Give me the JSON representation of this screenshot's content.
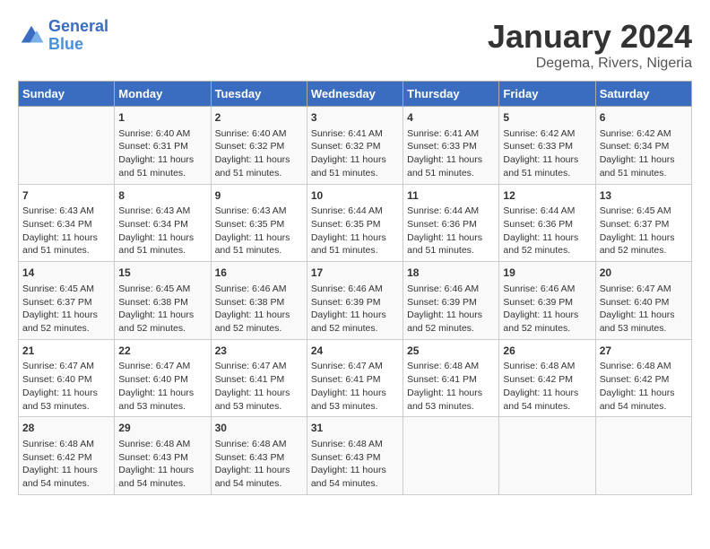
{
  "header": {
    "logo_line1": "General",
    "logo_line2": "Blue",
    "title": "January 2024",
    "subtitle": "Degema, Rivers, Nigeria"
  },
  "weekdays": [
    "Sunday",
    "Monday",
    "Tuesday",
    "Wednesday",
    "Thursday",
    "Friday",
    "Saturday"
  ],
  "weeks": [
    [
      {
        "day": "",
        "info": ""
      },
      {
        "day": "1",
        "info": "Sunrise: 6:40 AM\nSunset: 6:31 PM\nDaylight: 11 hours\nand 51 minutes."
      },
      {
        "day": "2",
        "info": "Sunrise: 6:40 AM\nSunset: 6:32 PM\nDaylight: 11 hours\nand 51 minutes."
      },
      {
        "day": "3",
        "info": "Sunrise: 6:41 AM\nSunset: 6:32 PM\nDaylight: 11 hours\nand 51 minutes."
      },
      {
        "day": "4",
        "info": "Sunrise: 6:41 AM\nSunset: 6:33 PM\nDaylight: 11 hours\nand 51 minutes."
      },
      {
        "day": "5",
        "info": "Sunrise: 6:42 AM\nSunset: 6:33 PM\nDaylight: 11 hours\nand 51 minutes."
      },
      {
        "day": "6",
        "info": "Sunrise: 6:42 AM\nSunset: 6:34 PM\nDaylight: 11 hours\nand 51 minutes."
      }
    ],
    [
      {
        "day": "7",
        "info": "Sunrise: 6:43 AM\nSunset: 6:34 PM\nDaylight: 11 hours\nand 51 minutes."
      },
      {
        "day": "8",
        "info": "Sunrise: 6:43 AM\nSunset: 6:34 PM\nDaylight: 11 hours\nand 51 minutes."
      },
      {
        "day": "9",
        "info": "Sunrise: 6:43 AM\nSunset: 6:35 PM\nDaylight: 11 hours\nand 51 minutes."
      },
      {
        "day": "10",
        "info": "Sunrise: 6:44 AM\nSunset: 6:35 PM\nDaylight: 11 hours\nand 51 minutes."
      },
      {
        "day": "11",
        "info": "Sunrise: 6:44 AM\nSunset: 6:36 PM\nDaylight: 11 hours\nand 51 minutes."
      },
      {
        "day": "12",
        "info": "Sunrise: 6:44 AM\nSunset: 6:36 PM\nDaylight: 11 hours\nand 52 minutes."
      },
      {
        "day": "13",
        "info": "Sunrise: 6:45 AM\nSunset: 6:37 PM\nDaylight: 11 hours\nand 52 minutes."
      }
    ],
    [
      {
        "day": "14",
        "info": "Sunrise: 6:45 AM\nSunset: 6:37 PM\nDaylight: 11 hours\nand 52 minutes."
      },
      {
        "day": "15",
        "info": "Sunrise: 6:45 AM\nSunset: 6:38 PM\nDaylight: 11 hours\nand 52 minutes."
      },
      {
        "day": "16",
        "info": "Sunrise: 6:46 AM\nSunset: 6:38 PM\nDaylight: 11 hours\nand 52 minutes."
      },
      {
        "day": "17",
        "info": "Sunrise: 6:46 AM\nSunset: 6:39 PM\nDaylight: 11 hours\nand 52 minutes."
      },
      {
        "day": "18",
        "info": "Sunrise: 6:46 AM\nSunset: 6:39 PM\nDaylight: 11 hours\nand 52 minutes."
      },
      {
        "day": "19",
        "info": "Sunrise: 6:46 AM\nSunset: 6:39 PM\nDaylight: 11 hours\nand 52 minutes."
      },
      {
        "day": "20",
        "info": "Sunrise: 6:47 AM\nSunset: 6:40 PM\nDaylight: 11 hours\nand 53 minutes."
      }
    ],
    [
      {
        "day": "21",
        "info": "Sunrise: 6:47 AM\nSunset: 6:40 PM\nDaylight: 11 hours\nand 53 minutes."
      },
      {
        "day": "22",
        "info": "Sunrise: 6:47 AM\nSunset: 6:40 PM\nDaylight: 11 hours\nand 53 minutes."
      },
      {
        "day": "23",
        "info": "Sunrise: 6:47 AM\nSunset: 6:41 PM\nDaylight: 11 hours\nand 53 minutes."
      },
      {
        "day": "24",
        "info": "Sunrise: 6:47 AM\nSunset: 6:41 PM\nDaylight: 11 hours\nand 53 minutes."
      },
      {
        "day": "25",
        "info": "Sunrise: 6:48 AM\nSunset: 6:41 PM\nDaylight: 11 hours\nand 53 minutes."
      },
      {
        "day": "26",
        "info": "Sunrise: 6:48 AM\nSunset: 6:42 PM\nDaylight: 11 hours\nand 54 minutes."
      },
      {
        "day": "27",
        "info": "Sunrise: 6:48 AM\nSunset: 6:42 PM\nDaylight: 11 hours\nand 54 minutes."
      }
    ],
    [
      {
        "day": "28",
        "info": "Sunrise: 6:48 AM\nSunset: 6:42 PM\nDaylight: 11 hours\nand 54 minutes."
      },
      {
        "day": "29",
        "info": "Sunrise: 6:48 AM\nSunset: 6:43 PM\nDaylight: 11 hours\nand 54 minutes."
      },
      {
        "day": "30",
        "info": "Sunrise: 6:48 AM\nSunset: 6:43 PM\nDaylight: 11 hours\nand 54 minutes."
      },
      {
        "day": "31",
        "info": "Sunrise: 6:48 AM\nSunset: 6:43 PM\nDaylight: 11 hours\nand 54 minutes."
      },
      {
        "day": "",
        "info": ""
      },
      {
        "day": "",
        "info": ""
      },
      {
        "day": "",
        "info": ""
      }
    ]
  ]
}
